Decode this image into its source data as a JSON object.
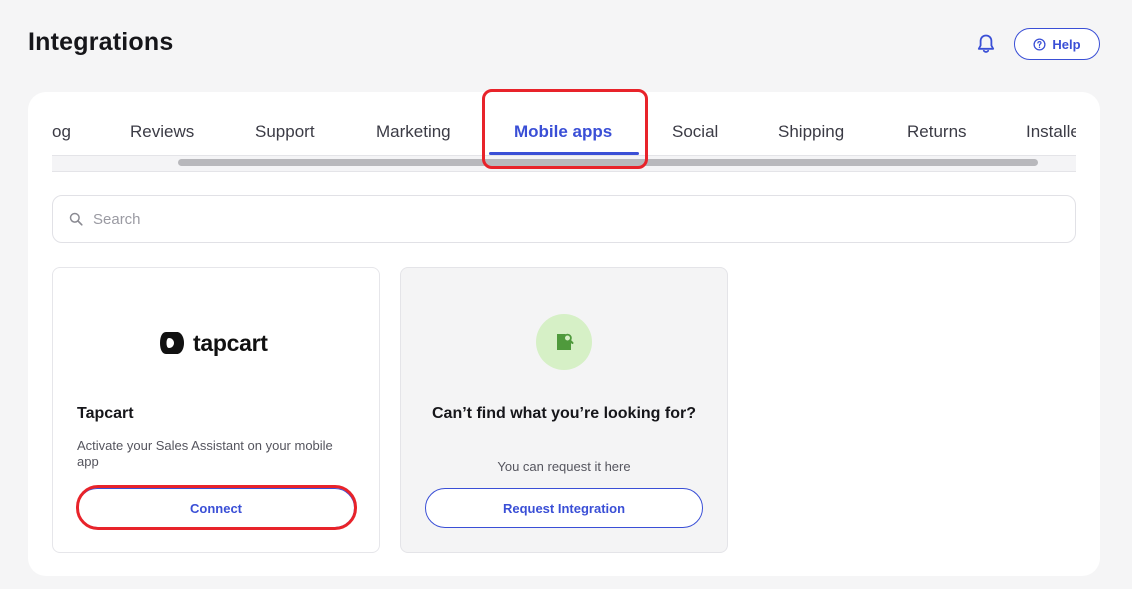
{
  "header": {
    "title": "Integrations",
    "help_label": "Help",
    "icons": {
      "notifications": "bell-icon",
      "help": "question-circle-icon"
    }
  },
  "tabs": {
    "items": [
      {
        "label": "og"
      },
      {
        "label": "Reviews"
      },
      {
        "label": "Support"
      },
      {
        "label": "Marketing"
      },
      {
        "label": "Mobile apps",
        "active": true
      },
      {
        "label": "Social"
      },
      {
        "label": "Shipping"
      },
      {
        "label": "Returns"
      },
      {
        "label": "Installe"
      }
    ]
  },
  "search": {
    "placeholder": "Search",
    "value": "",
    "icon": "search-icon"
  },
  "cards": {
    "tapcart": {
      "logo_text": "tapcart",
      "title": "Tapcart",
      "description": "Activate your Sales Assistant on your mobile app",
      "button_label": "Connect"
    },
    "request": {
      "icon": "document-search-icon",
      "title": "Can’t find what you’re looking for?",
      "subtitle": "You can request it here",
      "button_label": "Request Integration"
    }
  },
  "colors": {
    "accent": "#3a4fd6",
    "highlight": "#e8232a",
    "page_bg": "#f5f5f6",
    "request_icon_bg": "#d6f0c6",
    "request_icon_fg": "#4f9a3c"
  }
}
